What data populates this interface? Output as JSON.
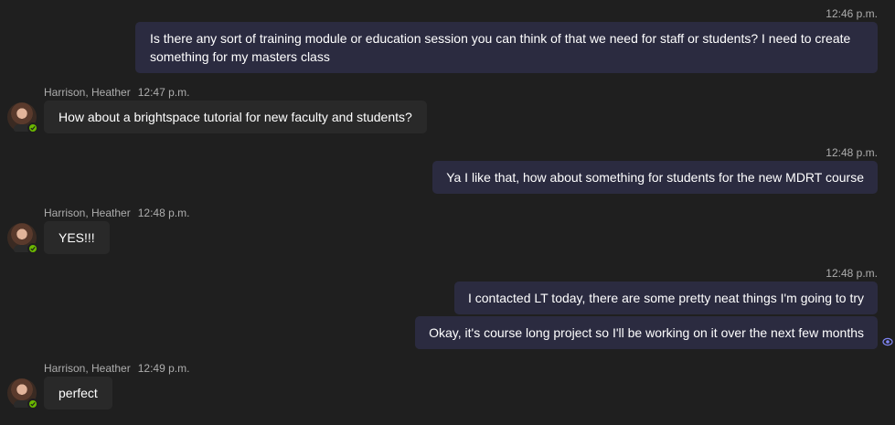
{
  "messages": {
    "m1": {
      "time": "12:46 p.m.",
      "line1": "Is there any sort of training module or education session you can think of that we need for staff or students? I need to create",
      "line2": "something for my masters class"
    },
    "m2": {
      "sender": "Harrison, Heather",
      "time": "12:47 p.m.",
      "text": "How about a brightspace tutorial for new faculty and students?"
    },
    "m3": {
      "time": "12:48 p.m.",
      "text": "Ya I like that, how about something for students for the new MDRT course"
    },
    "m4": {
      "sender": "Harrison, Heather",
      "time": "12:48 p.m.",
      "text": "YES!!!"
    },
    "m5": {
      "time": "12:48 p.m.",
      "text": "I contacted LT today, there are some pretty neat things I'm going to try"
    },
    "m6": {
      "text": "Okay, it's course long project so I'll be working on it over the next few months"
    },
    "m7": {
      "sender": "Harrison, Heather",
      "time": "12:49 p.m.",
      "text": "perfect"
    }
  },
  "colors": {
    "background": "#1f1f1f",
    "outgoing_bubble": "#2b2b40",
    "incoming_bubble": "#292929",
    "meta_text": "#adadad",
    "presence_available": "#6bb700",
    "read_receipt": "#7f85f5"
  },
  "icons": {
    "presence": "available-check-icon",
    "read_receipt": "seen-eye-icon"
  }
}
